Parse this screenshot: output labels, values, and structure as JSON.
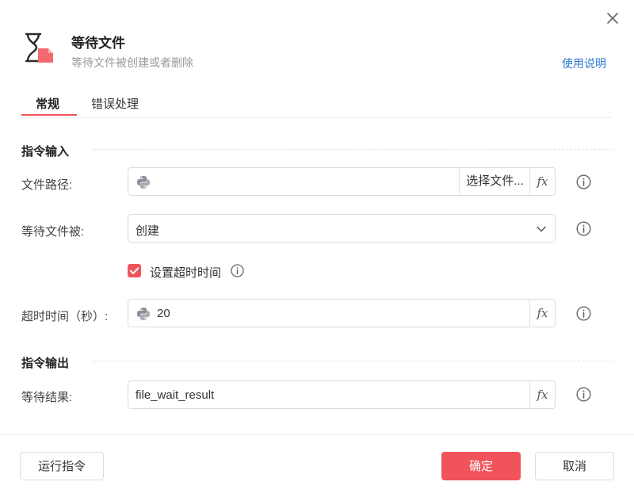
{
  "dialog": {
    "title": "等待文件",
    "subtitle": "等待文件被创建或者删除",
    "help_link": "使用说明"
  },
  "tabs": [
    {
      "label": "常规",
      "active": true
    },
    {
      "label": "错误处理",
      "active": false
    }
  ],
  "input_section": {
    "title": "指令输入",
    "file_path": {
      "label": "文件路径:",
      "value": "",
      "select_button": "选择文件..."
    },
    "wait_for": {
      "label": "等待文件被:",
      "selected": "创建"
    },
    "timeout_checkbox": {
      "label": "设置超时时间",
      "checked": true
    },
    "timeout": {
      "label": "超时时间（秒）:",
      "value": "20"
    }
  },
  "output_section": {
    "title": "指令输出",
    "result": {
      "label": "等待结果:",
      "value": "file_wait_result"
    }
  },
  "footer": {
    "run_button": "运行指令",
    "confirm_button": "确定",
    "cancel_button": "取消"
  },
  "colors": {
    "accent": "#f0545a",
    "link": "#2e7ad1"
  },
  "icons": {
    "title": "wait-file-icon",
    "close": "close-icon",
    "python": "python-icon",
    "info": "info-icon",
    "dropdown": "chevron-down-icon",
    "checkbox": "check-icon"
  }
}
